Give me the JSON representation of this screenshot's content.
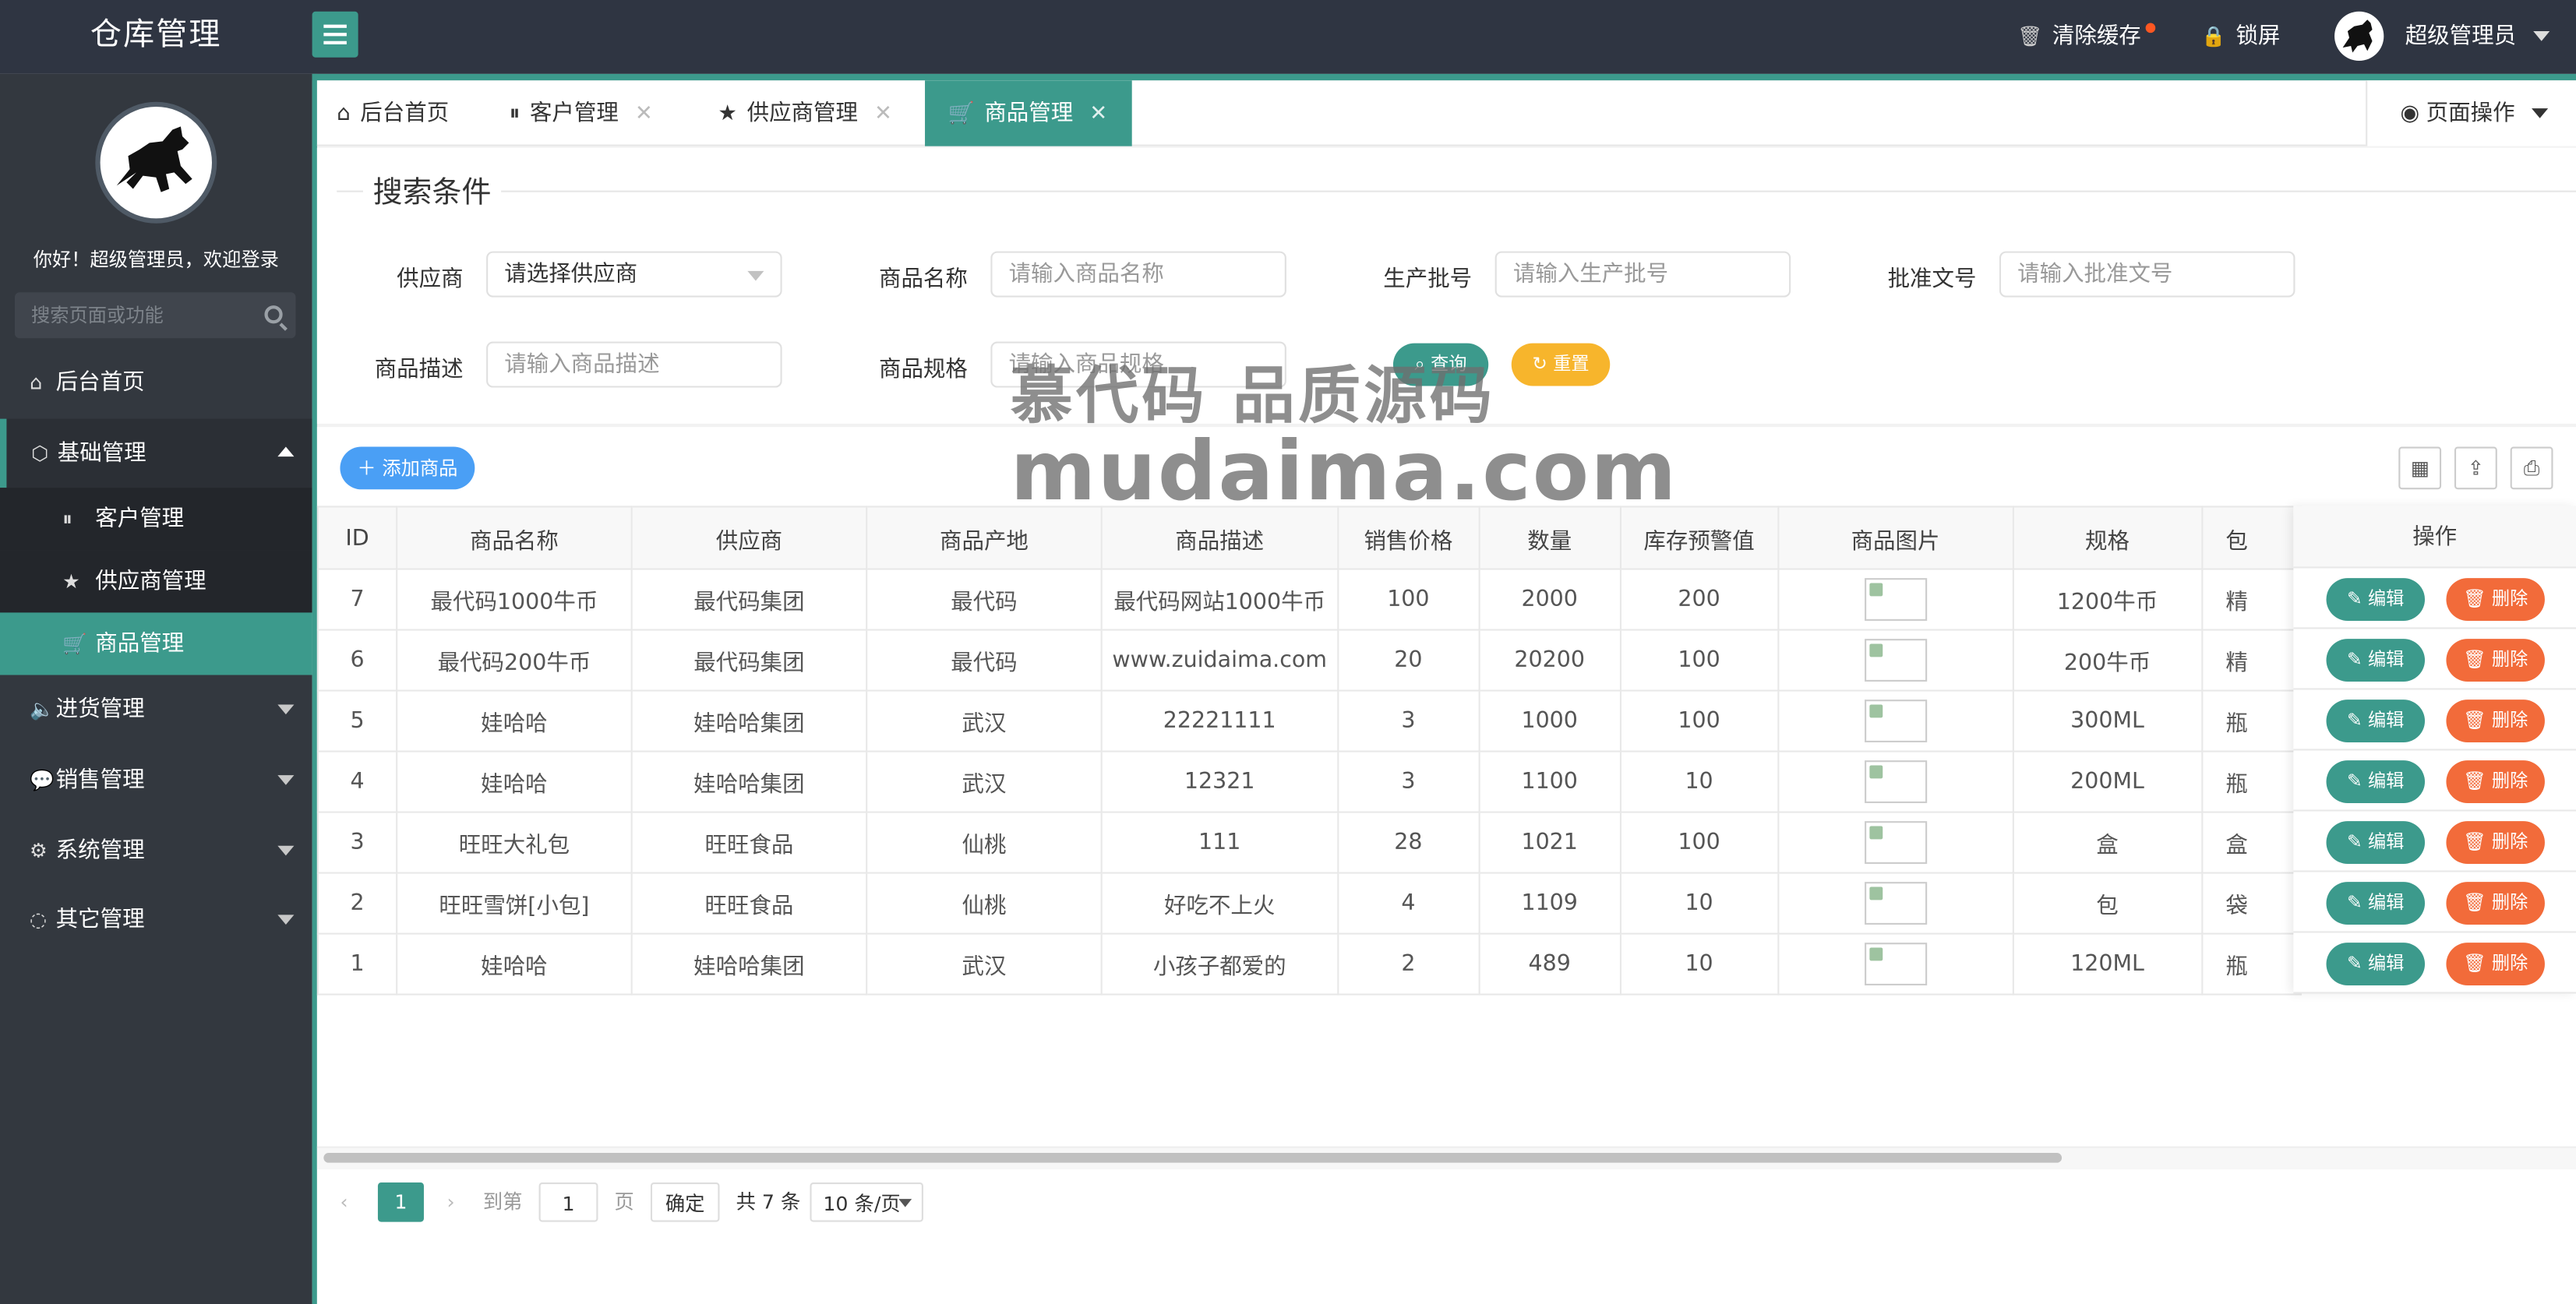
{
  "header": {
    "app_title": "仓库管理",
    "clear_cache": "清除缓存",
    "lock_screen": "锁屏",
    "user_name": "超级管理员"
  },
  "sidebar": {
    "welcome": "你好！超级管理员，欢迎登录",
    "search_placeholder": "搜索页面或功能",
    "items": [
      {
        "label": "后台首页",
        "icon": "home-icon"
      },
      {
        "label": "基础管理",
        "icon": "cube-icon",
        "expanded": true,
        "children": [
          {
            "label": "客户管理",
            "icon": "pause-circle-icon"
          },
          {
            "label": "供应商管理",
            "icon": "star-icon"
          },
          {
            "label": "商品管理",
            "icon": "cart-icon",
            "active": true
          }
        ]
      },
      {
        "label": "进货管理",
        "icon": "volume-icon"
      },
      {
        "label": "销售管理",
        "icon": "chat-icon"
      },
      {
        "label": "系统管理",
        "icon": "gear-icon"
      },
      {
        "label": "其它管理",
        "icon": "circle-dashed-icon"
      }
    ]
  },
  "tabs": [
    {
      "label": "后台首页",
      "icon": "home-icon"
    },
    {
      "label": "客户管理",
      "icon": "pause-circle-icon"
    },
    {
      "label": "供应商管理",
      "icon": "star-icon"
    },
    {
      "label": "商品管理",
      "icon": "cart-icon",
      "active": true
    }
  ],
  "page_ops": "页面操作",
  "search": {
    "legend": "搜索条件",
    "fields": [
      {
        "label": "供应商",
        "value": "请选择供应商"
      },
      {
        "label": "商品名称",
        "placeholder": "请输入商品名称"
      },
      {
        "label": "生产批号",
        "placeholder": "请输入生产批号"
      },
      {
        "label": "批准文号",
        "placeholder": "请输入批准文号"
      },
      {
        "label": "商品描述",
        "placeholder": "请输入商品描述"
      },
      {
        "label": "商品规格",
        "placeholder": "请输入商品规格"
      }
    ],
    "query_label": "查询",
    "reset_label": "重置"
  },
  "toolbar": {
    "add_label": "添加商品"
  },
  "table": {
    "columns": [
      "ID",
      "商品名称",
      "供应商",
      "商品产地",
      "商品描述",
      "销售价格",
      "数量",
      "库存预警值",
      "商品图片",
      "规格",
      "包",
      "操作"
    ],
    "rows": [
      {
        "id": "7",
        "name": "最代码1000牛币",
        "supplier": "最代码集团",
        "origin": "最代码",
        "desc": "最代码网站1000牛币",
        "price": "100",
        "qty": "2000",
        "warn": "200",
        "spec": "1200牛币",
        "pack": "精"
      },
      {
        "id": "6",
        "name": "最代码200牛币",
        "supplier": "最代码集团",
        "origin": "最代码",
        "desc": "www.zuidaima.com",
        "price": "20",
        "qty": "20200",
        "warn": "100",
        "spec": "200牛币",
        "pack": "精"
      },
      {
        "id": "5",
        "name": "娃哈哈",
        "supplier": "娃哈哈集团",
        "origin": "武汉",
        "desc": "22221111",
        "price": "3",
        "qty": "1000",
        "warn": "100",
        "spec": "300ML",
        "pack": "瓶"
      },
      {
        "id": "4",
        "name": "娃哈哈",
        "supplier": "娃哈哈集团",
        "origin": "武汉",
        "desc": "12321",
        "price": "3",
        "qty": "1100",
        "warn": "10",
        "spec": "200ML",
        "pack": "瓶"
      },
      {
        "id": "3",
        "name": "旺旺大礼包",
        "supplier": "旺旺食品",
        "origin": "仙桃",
        "desc": "111",
        "price": "28",
        "qty": "1021",
        "warn": "100",
        "spec": "盒",
        "pack": "盒"
      },
      {
        "id": "2",
        "name": "旺旺雪饼[小包]",
        "supplier": "旺旺食品",
        "origin": "仙桃",
        "desc": "好吃不上火",
        "price": "4",
        "qty": "1109",
        "warn": "10",
        "spec": "包",
        "pack": "袋"
      },
      {
        "id": "1",
        "name": "娃哈哈",
        "supplier": "娃哈哈集团",
        "origin": "武汉",
        "desc": "小孩子都爱的",
        "price": "2",
        "qty": "489",
        "warn": "10",
        "spec": "120ML",
        "pack": "瓶"
      }
    ],
    "edit_label": "编辑",
    "delete_label": "删除"
  },
  "pager": {
    "current": "1",
    "goto_label": "到第",
    "goto_value": "1",
    "page_unit": "页",
    "confirm": "确定",
    "total": "共 7 条",
    "page_size": "10 条/页"
  },
  "watermark": {
    "line1": "慕代码 品质源码",
    "line2": "mudaima.com"
  },
  "colors": {
    "topbar": "#2f3542",
    "sidebar": "#33383f",
    "accent": "#3c9a8c",
    "primary_blue": "#4a9ff5",
    "danger": "#f26b3a",
    "warning": "#f7b52c"
  }
}
